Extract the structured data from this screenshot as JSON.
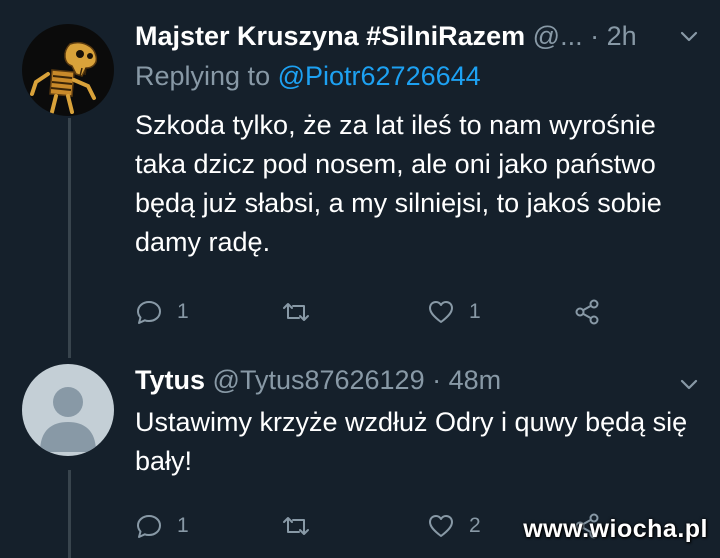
{
  "colors": {
    "background": "#15202b",
    "text_primary": "#ffffff",
    "text_secondary": "#8899a6",
    "link": "#1da1f2",
    "thread_line": "#38444d"
  },
  "tweets": [
    {
      "display_name": "Majster Kruszyna #SilniRazem",
      "handle": "@...",
      "separator": "·",
      "time": "2h",
      "replying_label": "Replying to ",
      "replying_to": "@Piotr62726644",
      "text": "Szkoda tylko, że za lat ileś to nam wyrośnie taka dzicz pod nosem, ale oni jako państwo będą już słabsi, a my silniejsi, to jakoś sobie damy radę.",
      "avatar_icon": "skeleton-avatar",
      "reply_count": "1",
      "retweet_count": "",
      "like_count": "1"
    },
    {
      "display_name": "Tytus",
      "handle": "@Tytus87626129",
      "separator": "·",
      "time": "48m",
      "text": "Ustawimy krzyże wzdłuż Odry i quwy będą się bały!",
      "avatar_icon": "default-user-avatar",
      "reply_count": "1",
      "retweet_count": "",
      "like_count": "2"
    }
  ],
  "icons": {
    "reply": "reply-icon",
    "retweet": "retweet-icon",
    "like": "heart-icon",
    "share": "share-icon",
    "more": "chevron-down-icon"
  },
  "watermark": "www.wiocha.pl"
}
